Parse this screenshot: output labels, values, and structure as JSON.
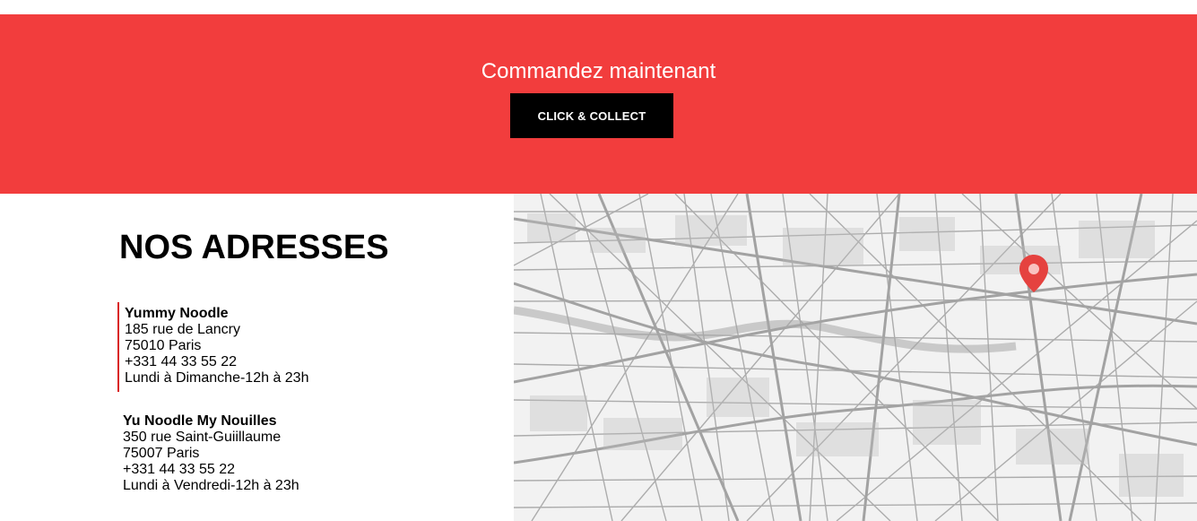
{
  "cta": {
    "title": "Commandez maintenant",
    "button_label": "CLICK & COLLECT",
    "background_color": "#f23d3d",
    "button_color": "#000000"
  },
  "addresses": {
    "title": "NOS ADRESSES",
    "items": [
      {
        "name": "Yummy Noodle",
        "street": "185 rue de Lancry",
        "city": "75010 Paris",
        "phone": "+331 44 33 55 22",
        "hours": "Lundi à Dimanche-12h à 23h"
      },
      {
        "name": "Yu Noodle My Nouilles",
        "street": "350 rue Saint-Guiillaume",
        "city": "75007 Paris",
        "phone": "+331 44 33 55 22",
        "hours": "Lundi à Vendredi-12h à 23h"
      }
    ]
  },
  "map": {
    "marker_icon": "map-pin-icon",
    "marker_color": "#e5423f"
  }
}
